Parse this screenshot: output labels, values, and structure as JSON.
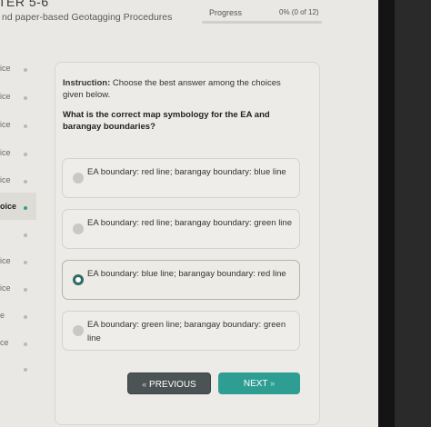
{
  "header": {
    "course_code": "TER 5-6",
    "course_title": "nd paper-based Geotagging Procedures",
    "progress_label": "Progress",
    "progress_text": "0% (0 of 12)",
    "progress_fraction": 0
  },
  "sidebar": {
    "items": [
      {
        "label": "ice"
      },
      {
        "label": "ice"
      },
      {
        "label": "ice"
      },
      {
        "label": "ice"
      },
      {
        "label": "ice"
      },
      {
        "label": "oice"
      },
      {
        "label": "ice"
      },
      {
        "label": "ice"
      },
      {
        "label": "e"
      },
      {
        "label": "ce"
      }
    ]
  },
  "question": {
    "instruction_label": "Instruction:",
    "instruction_text": " Choose the best answer among the choices given below.",
    "prompt": "What is the correct map symbology for the EA and barangay boundaries?",
    "options": [
      {
        "text": "EA boundary: red line; barangay boundary: blue line",
        "selected": false
      },
      {
        "text": "EA boundary: red line; barangay boundary: green line",
        "selected": false
      },
      {
        "text": "EA boundary: blue line; barangay boundary: red line",
        "selected": true
      },
      {
        "text": "EA boundary: green line; barangay boundary: green line",
        "selected": false
      }
    ]
  },
  "nav": {
    "prev_label": "PREVIOUS",
    "prev_icon": "«",
    "next_label": "NEXT",
    "next_icon": "»"
  },
  "colors": {
    "accent": "#2e9e93",
    "prev_button": "#4b5354",
    "next_button": "#2f9e92"
  }
}
